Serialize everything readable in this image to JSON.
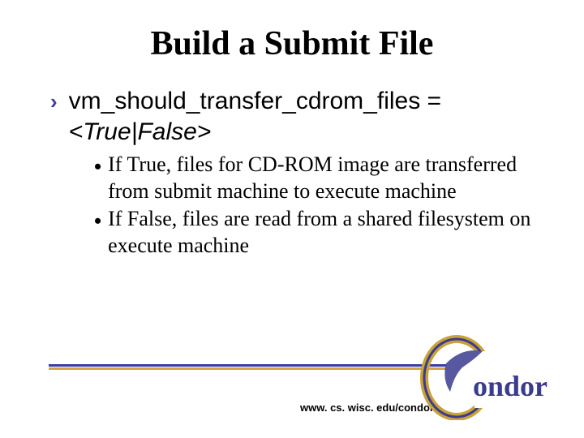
{
  "title": "Build a Submit File",
  "bullet": {
    "line1": "vm_should_transfer_cdrom_files =",
    "line2_italic": "<True|False>"
  },
  "sub_bullets": [
    "If True, files for CD-ROM image are transferred from submit machine to execute machine",
    "If False, files are read from a shared filesystem on execute machine"
  ],
  "footer_url": "www. cs. wisc. edu/condor",
  "logo_text": "ondor"
}
